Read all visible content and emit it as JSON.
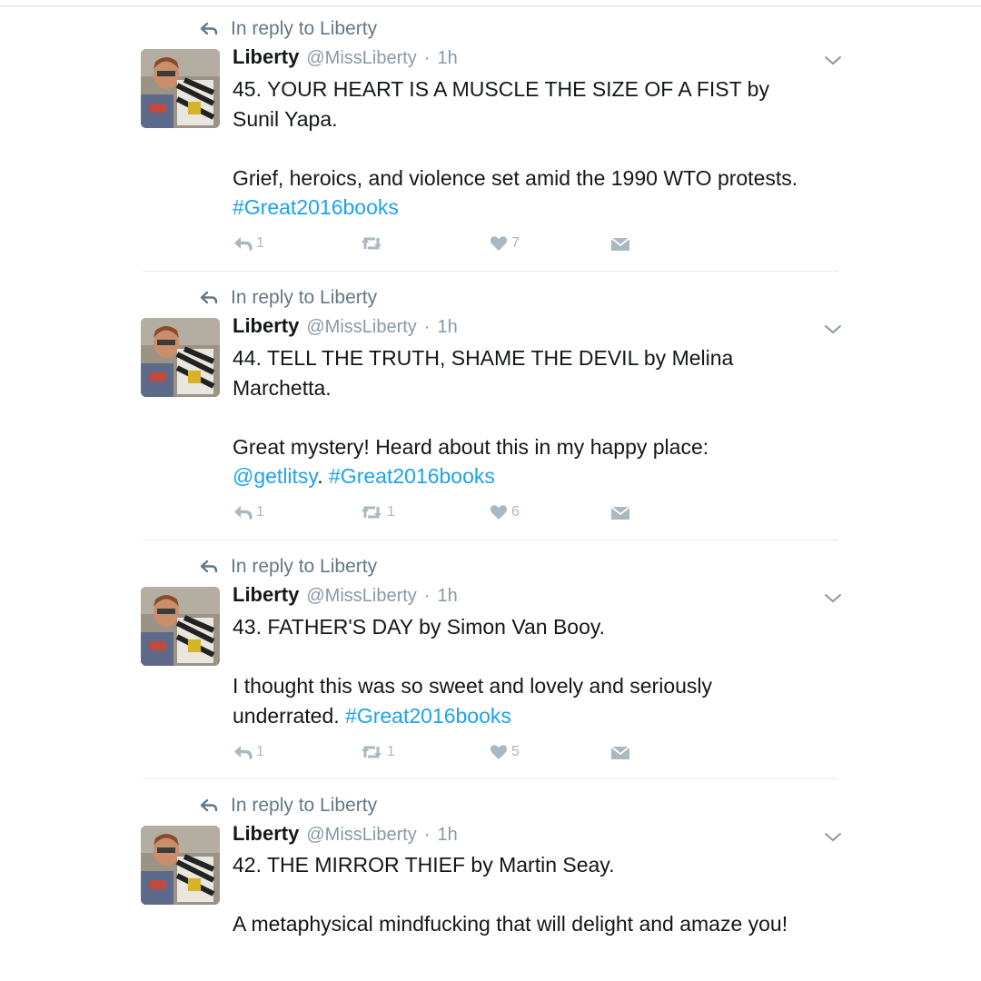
{
  "tweets": [
    {
      "reply_to": "In reply to Liberty",
      "name": "Liberty",
      "handle": "@MissLiberty",
      "separator": "·",
      "time": "1h",
      "text_main": "45. YOUR HEART IS A MUSCLE THE SIZE OF A FIST by Sunil Yapa.\n\nGrief, heroics, and violence set amid the 1990 WTO protests. ",
      "mention": "",
      "mid_text": "",
      "hashtag": "#Great2016books",
      "replies": "1",
      "retweets": "",
      "likes": "7"
    },
    {
      "reply_to": "In reply to Liberty",
      "name": "Liberty",
      "handle": "@MissLiberty",
      "separator": "·",
      "time": "1h",
      "text_main": "44. TELL THE TRUTH, SHAME THE DEVIL by Melina Marchetta.\n\nGreat mystery! Heard about this in my happy place:\n",
      "mention": "@getlitsy",
      "mid_text": ". ",
      "hashtag": "#Great2016books",
      "replies": "1",
      "retweets": "1",
      "likes": "6"
    },
    {
      "reply_to": "In reply to Liberty",
      "name": "Liberty",
      "handle": "@MissLiberty",
      "separator": "·",
      "time": "1h",
      "text_main": "43. FATHER'S DAY by Simon Van Booy.\n\nI thought this was so sweet and lovely and seriously underrated. ",
      "mention": "",
      "mid_text": "",
      "hashtag": "#Great2016books",
      "replies": "1",
      "retweets": "1",
      "likes": "5"
    },
    {
      "reply_to": "In reply to Liberty",
      "name": "Liberty",
      "handle": "@MissLiberty",
      "separator": "·",
      "time": "1h",
      "text_main": "42. THE MIRROR THIEF by Martin Seay.\n\nA metaphysical mindfucking that will delight and amaze you!",
      "mention": "",
      "mid_text": "",
      "hashtag": "",
      "replies": "",
      "retweets": "",
      "likes": ""
    }
  ],
  "icons": {
    "reply": "reply-arrow-icon",
    "retweet": "retweet-icon",
    "like": "heart-icon",
    "dm": "envelope-icon",
    "menu": "chevron-down-icon"
  },
  "colors": {
    "link": "#1da1f2",
    "muted": "#657786",
    "action": "#aab8c2"
  }
}
